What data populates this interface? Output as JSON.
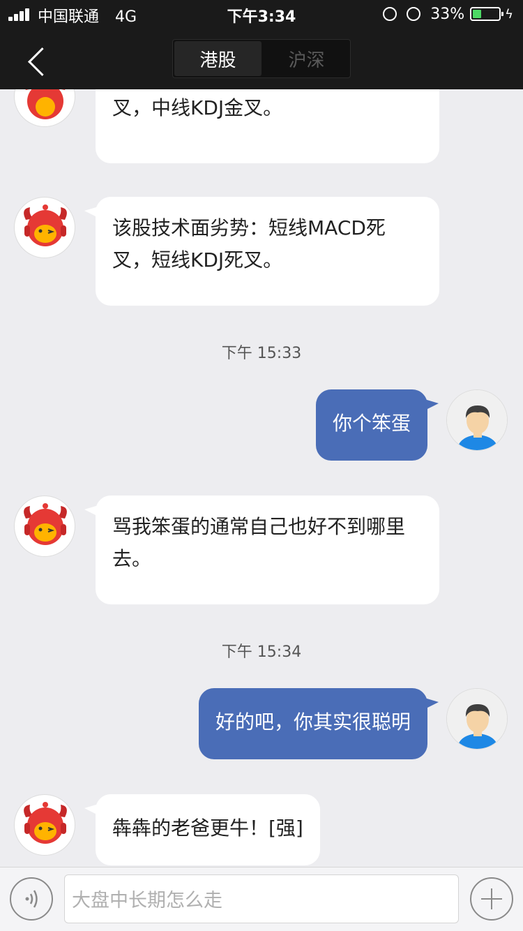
{
  "status_bar": {
    "carrier": "中国联通",
    "network": "4G",
    "time": "下午3:34",
    "battery": "33%"
  },
  "header": {
    "tabs": [
      {
        "label": "港股",
        "active": true
      },
      {
        "label": "沪深",
        "active": false
      }
    ]
  },
  "messages": [
    {
      "type": "bot",
      "text": "该股技术面优势：中线MACD金叉，中线KDJ金叉。"
    },
    {
      "type": "bot",
      "text": "该股技术面劣势：短线MACD死叉，短线KDJ死叉。"
    },
    {
      "type": "timestamp",
      "text": "下午 15:33"
    },
    {
      "type": "user",
      "text": "你个笨蛋"
    },
    {
      "type": "bot",
      "text": "骂我笨蛋的通常自己也好不到哪里去。"
    },
    {
      "type": "timestamp",
      "text": "下午 15:34"
    },
    {
      "type": "user",
      "text": "好的吧，你其实很聪明"
    },
    {
      "type": "bot",
      "text": "犇犇的老爸更牛！[强]"
    }
  ],
  "input": {
    "placeholder": "大盘中长期怎么走"
  },
  "icons": {
    "back": "chevron-left-icon",
    "voice": "voice-icon",
    "plus": "plus-icon",
    "bot_avatar": "bull-mascot-avatar",
    "user_avatar": "user-avatar"
  },
  "colors": {
    "user_bubble": "#4a6db7",
    "bot_bubble": "#ffffff",
    "background": "#ededf0",
    "header": "#1a1a1a",
    "battery": "#4cd964"
  }
}
